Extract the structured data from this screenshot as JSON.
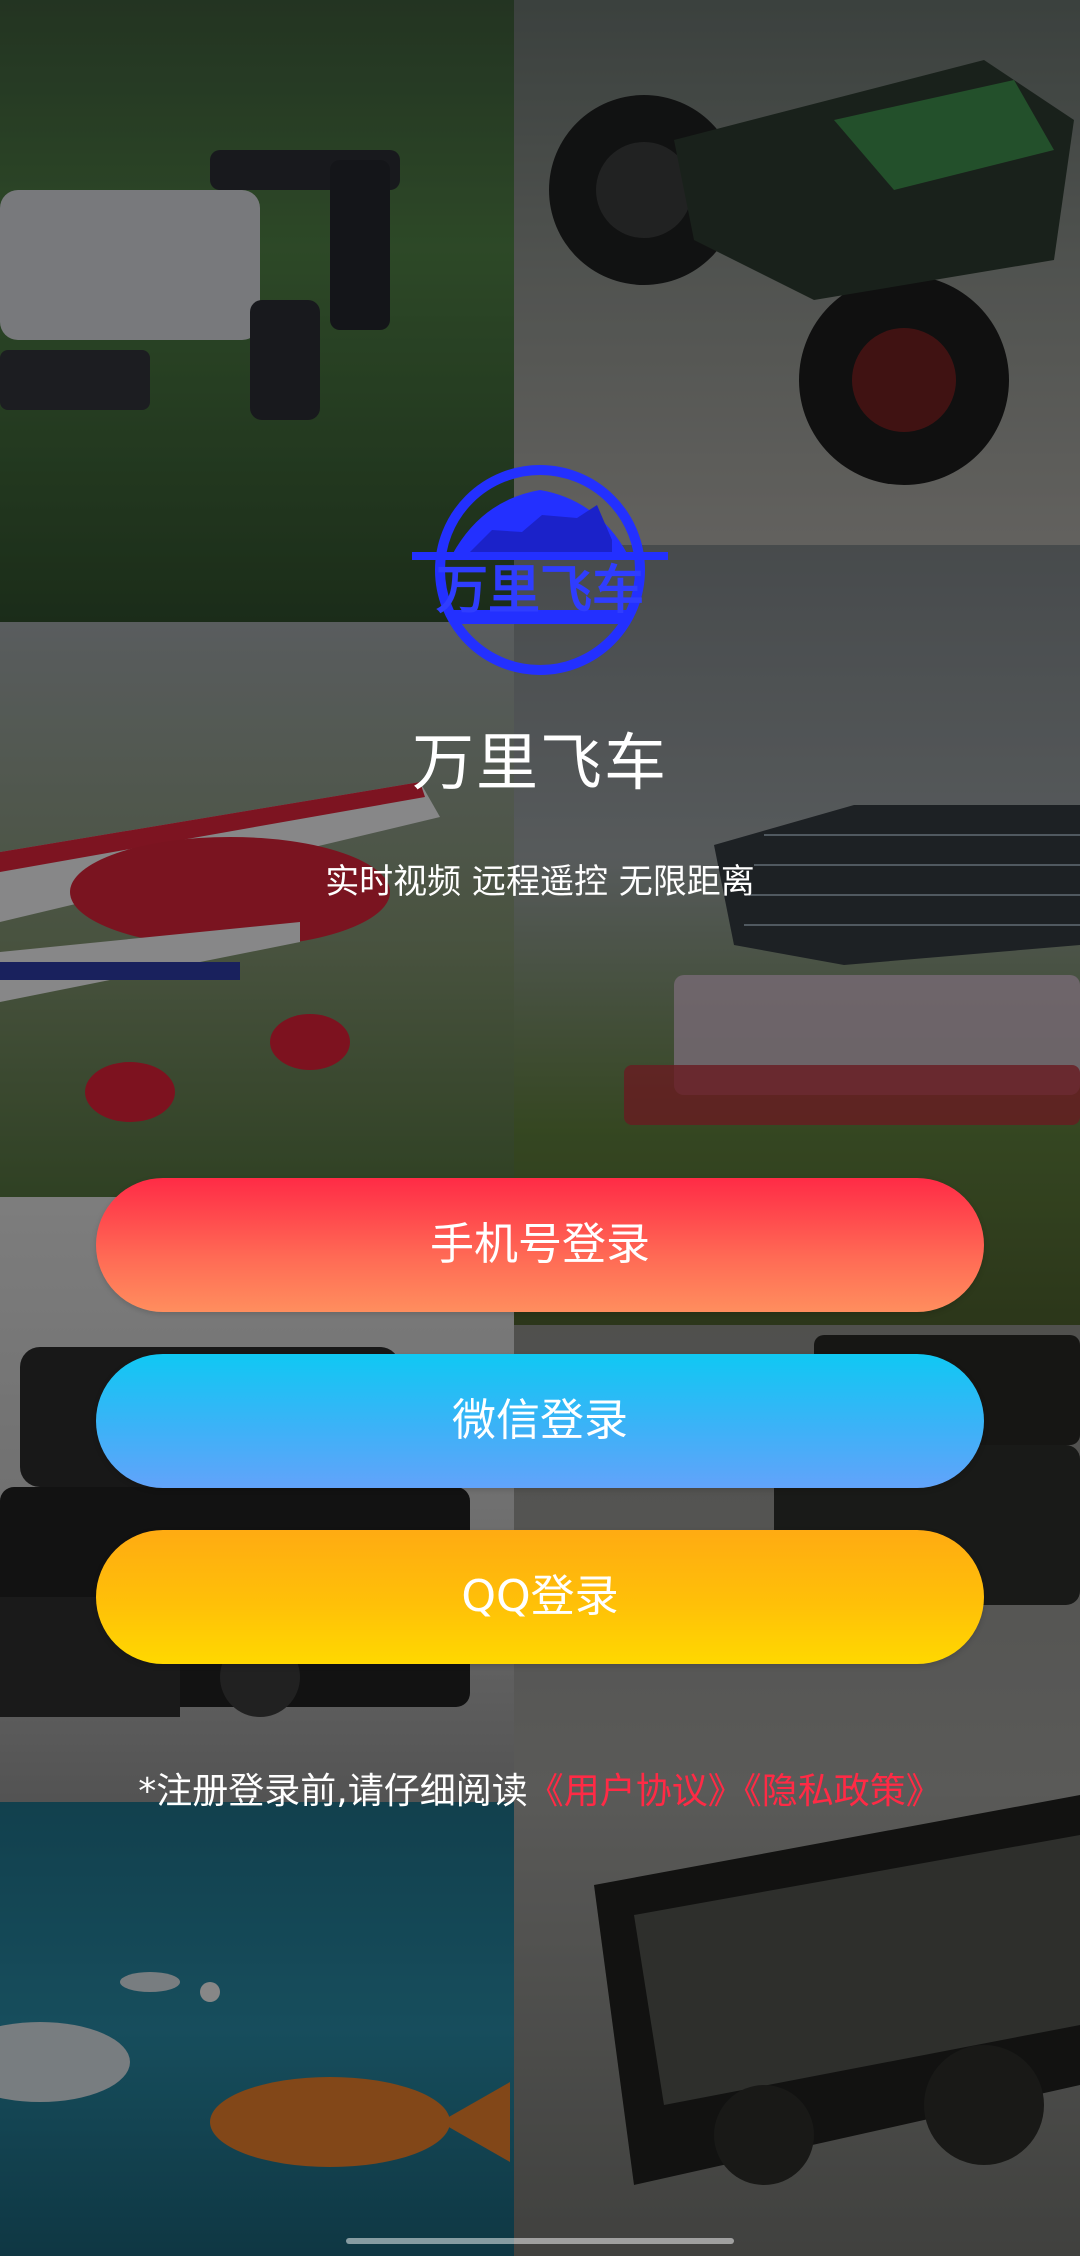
{
  "app": {
    "title": "万里飞车",
    "subtitle": "实时视频 远程遥控 无限距离",
    "logo_text": "万里飞车"
  },
  "buttons": {
    "phone_login": "手机号登录",
    "wechat_login": "微信登录",
    "qq_login": "QQ登录"
  },
  "agreement": {
    "prefix": "*注册登录前,请仔细阅读",
    "user_agreement": "《用户协议》",
    "privacy_policy": "《隐私政策》"
  },
  "colors": {
    "link": "#ff2a45",
    "logo_blue": "#2330ff"
  },
  "background": {
    "images": [
      "quadcopter-drone",
      "rc-buggy",
      "red-rc-plane",
      "solar-boat",
      "hexacopter-drone",
      "rc-tank",
      "underwater-drone"
    ]
  }
}
